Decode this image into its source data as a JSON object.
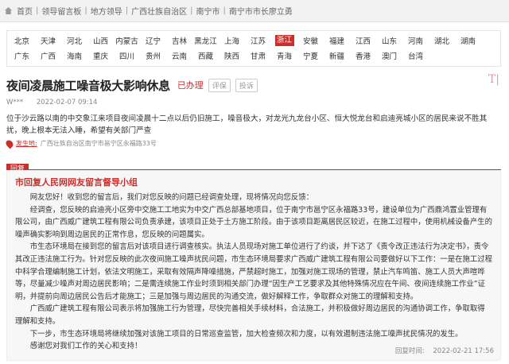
{
  "breadcrumb": [
    "首页",
    "领导留言板",
    "地方领导",
    "广西壮族自治区",
    "南宁市",
    "南宁市市长廖立勇"
  ],
  "breadcrumb_sep": "|",
  "regions": {
    "row1": [
      "北京",
      "天津",
      "河北",
      "山西",
      "内蒙古",
      "辽宁",
      "吉林",
      "黑龙江",
      "上海",
      "江苏",
      "浙江",
      "安徽",
      "福建",
      "江西",
      "山东",
      "河南",
      "湖北",
      "湖南"
    ],
    "row2": [
      "广东",
      "广西",
      "海南",
      "重庆",
      "四川",
      "贵州",
      "云南",
      "西藏",
      "陕西",
      "甘肃",
      "青海",
      "宁夏",
      "新疆",
      "香港",
      "澳门",
      "台湾"
    ],
    "selected": "浙江"
  },
  "post": {
    "title": "夜间凌晨施工噪音极大影响休息",
    "status": "已办理",
    "btn_eval": "评保",
    "btn_report": "投诉",
    "author": "W***",
    "time": "2022-02-07 09:14",
    "body": "位于沙云路以南的中交象江来项目夜间凌晨十二点以后仍旧施工，噪音极大，对龙光九龙台小区、恒大悦龙台和启迪亮城小区的居民来说不胜其扰，晚上根本无法入睡，希望有关部门严查",
    "loc_label": "发生地:",
    "loc_value": "广西壮族自治区南宁市邕宁区永福路33号"
  },
  "reply": {
    "tab": "回复",
    "office": "市回复人民网网友留言督导小组",
    "paragraphs": [
      "网友您好！收到您的留言后，我们对您反映的问题已经调查处理，现将情况向您反馈：",
      "经调查，您反映的启迪亮小区旁中交施工工地实为中交广西总部基地项目，位于南宁市邕宁区永福路33号，建设单位为广西鼎鸿置业管理有限公司，由广西威广建筑工程有限公司负责承建，该项目正处于土方施工阶段。由于该项目距离居民区较近，在施工过程中，使用机械设备产生的噪声确实影响到周边居民的正常作息，您反映的问题属实。",
      "市生态环境局在接到您的留言后对该项目进行调查核实。执法人员现场对施工单位进行了约谈，并下达了《责令改正违法行为决定书》，责令其改正违法施工行为。针对您反映的此次夜间施工噪声扰民问题，市生态环境局要求广西威广建筑工程有限公司要做好以下工作：一是在施工过程中科学合理编制施工计划，依法文明施工，采取有效隔声降噪措施，严禁超时施工，加强对施工现场的管理，禁止汽车鸣笛、施工人员大声喧哗等，尽量减少噪声对周边居民影响；二是需连续施工作业时须到相关部门办理“因生产工艺要求及其他特殊情况应在午间、夜间连续施工作业”证明，并提前向周边居民公告后才能施工；三是加强与周边居民的沟通交流，做好解释工作，争取群众对施工的理解和支持。",
      "广西威广建筑工程有限公司表示将加强施工行为管理，尽快完善相关手续材料，合法施工，并积极做好周边居民的沟通协调工作，争取取得理解和支持。",
      "下一步，市生态环境局将继续加强对该施工项目的日常巡查监管，加大检查频次和力度，以有效遏制违法施工噪声扰民情况的发生。",
      "感谢您对我们工作的关心和支持！"
    ],
    "time_label": "回复时间:",
    "time": "2022-02-21 17:56"
  }
}
